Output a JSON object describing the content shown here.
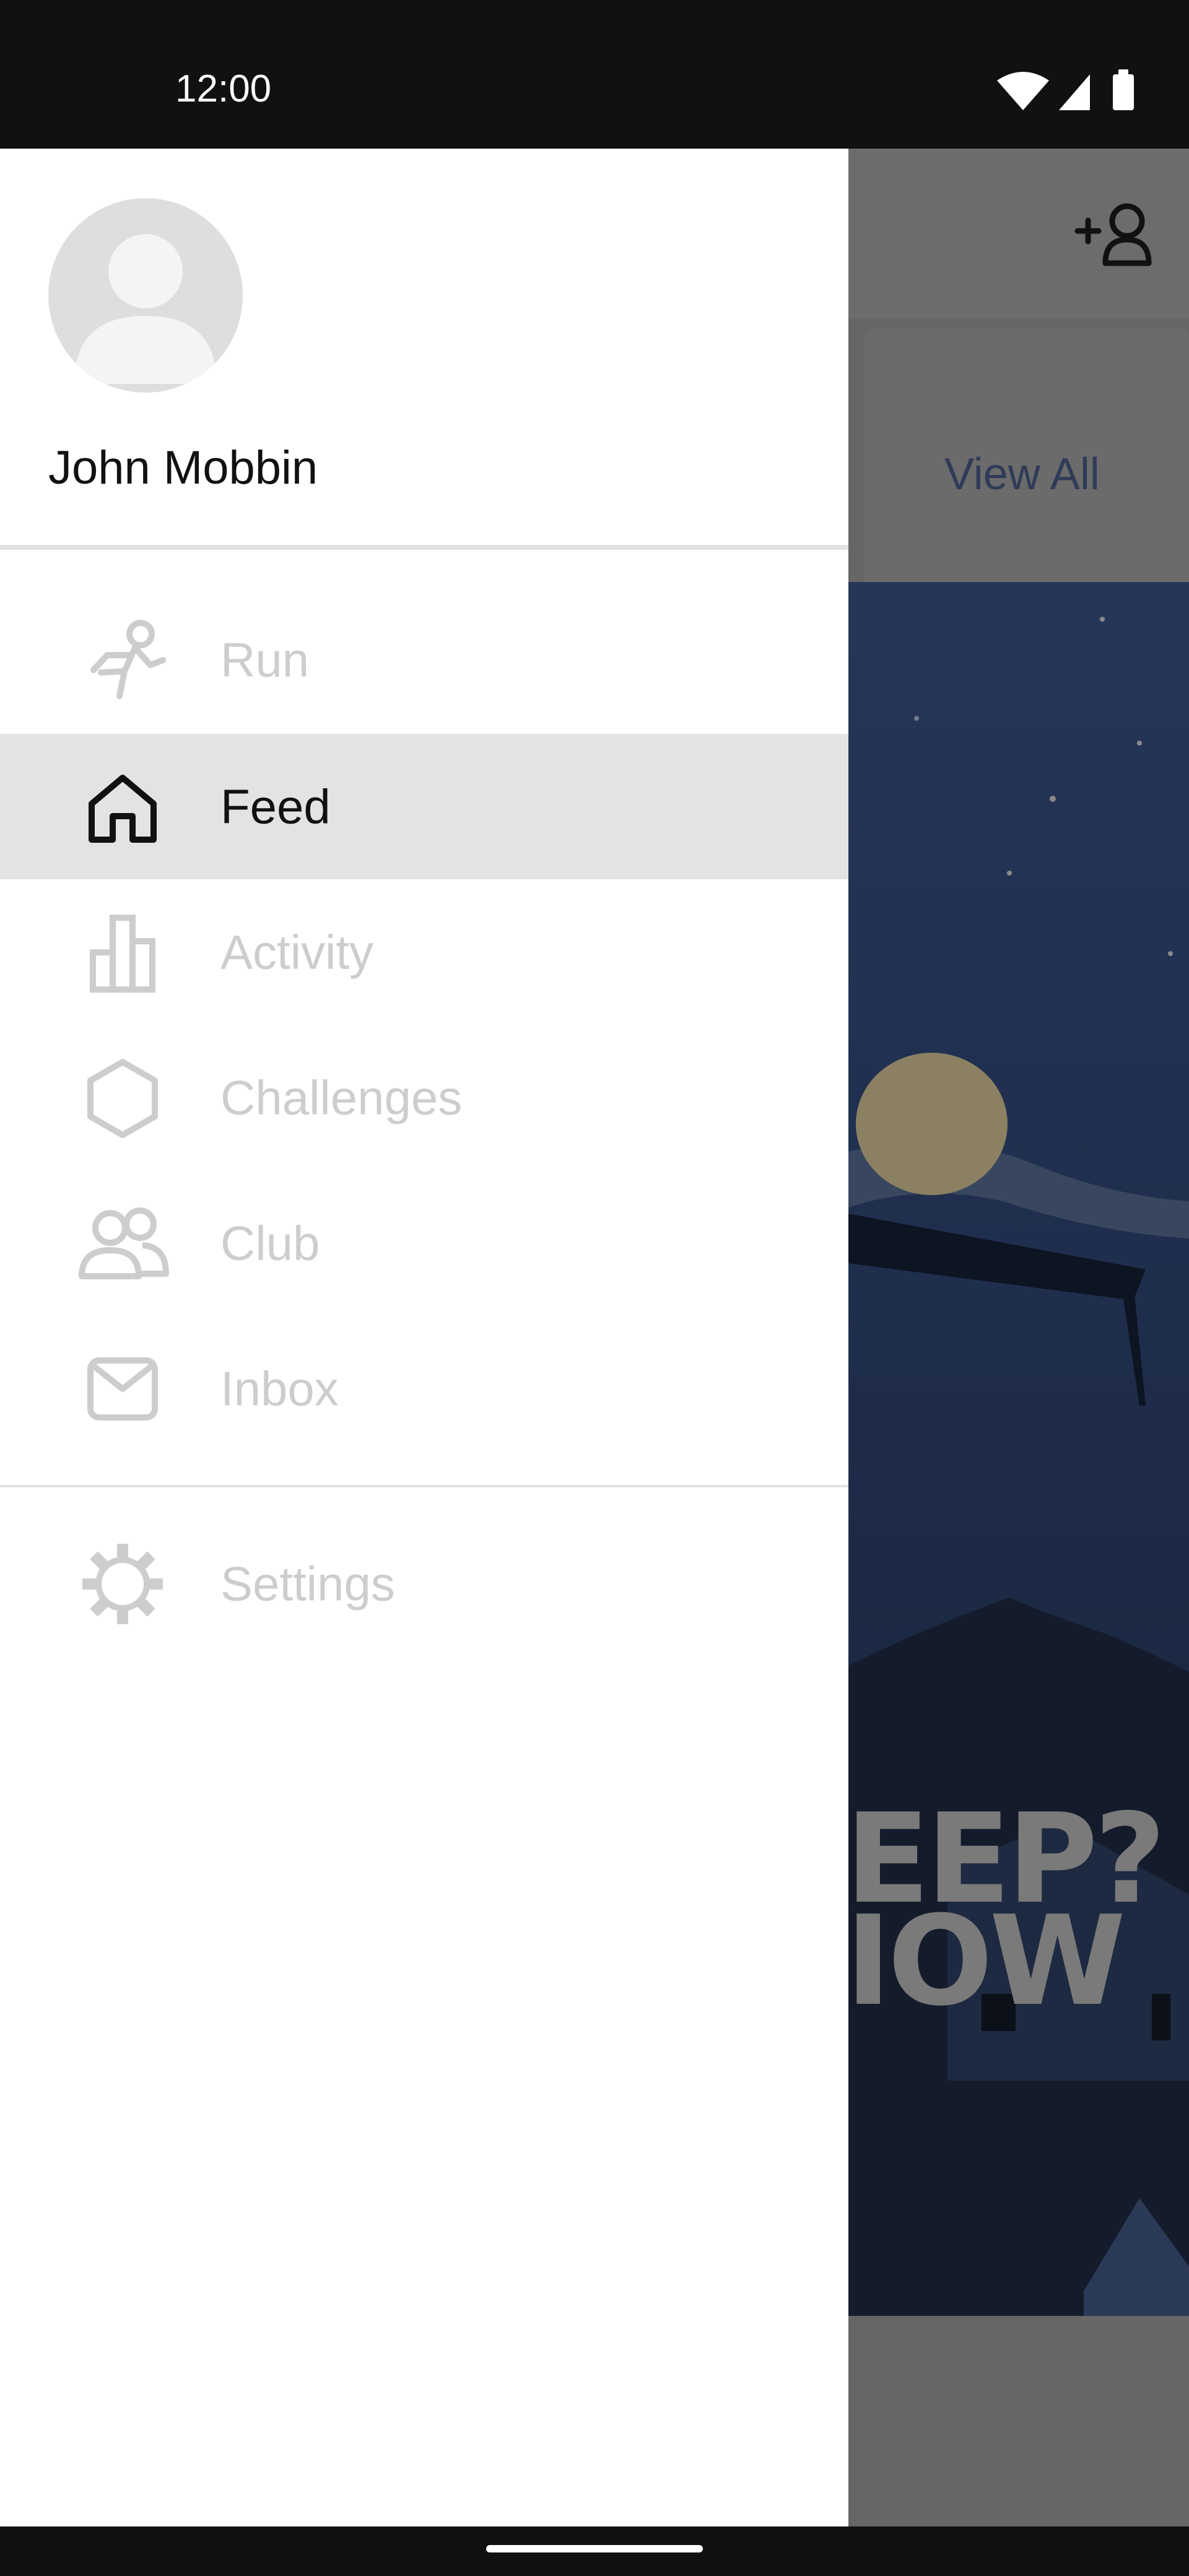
{
  "status_bar": {
    "time": "12:00",
    "icons": [
      "wifi-icon",
      "cellular-signal-icon",
      "battery-icon"
    ]
  },
  "background_app": {
    "view_all_label": "View All",
    "header_icon": "add-friend-icon",
    "banner_text_line1": "EEP?",
    "banner_text_line2": "IOW"
  },
  "drawer": {
    "user": {
      "name": "John Mobbin",
      "avatar_icon": "default-avatar-icon"
    },
    "menu_items": [
      {
        "label": "Run",
        "icon": "running-shoe-icon",
        "active": false
      },
      {
        "label": "Feed",
        "icon": "home-icon",
        "active": true
      },
      {
        "label": "Activity",
        "icon": "bar-chart-icon",
        "active": false
      },
      {
        "label": "Challenges",
        "icon": "hexagon-icon",
        "active": false
      },
      {
        "label": "Club",
        "icon": "people-icon",
        "active": false
      },
      {
        "label": "Inbox",
        "icon": "envelope-icon",
        "active": false
      }
    ],
    "secondary_items": [
      {
        "label": "Settings",
        "icon": "gear-icon",
        "active": false
      }
    ]
  },
  "colors": {
    "active_item_bg": "#e3e3e3",
    "inactive_text": "#cdcdcd",
    "active_text": "#111111",
    "scrim": "#666666"
  }
}
